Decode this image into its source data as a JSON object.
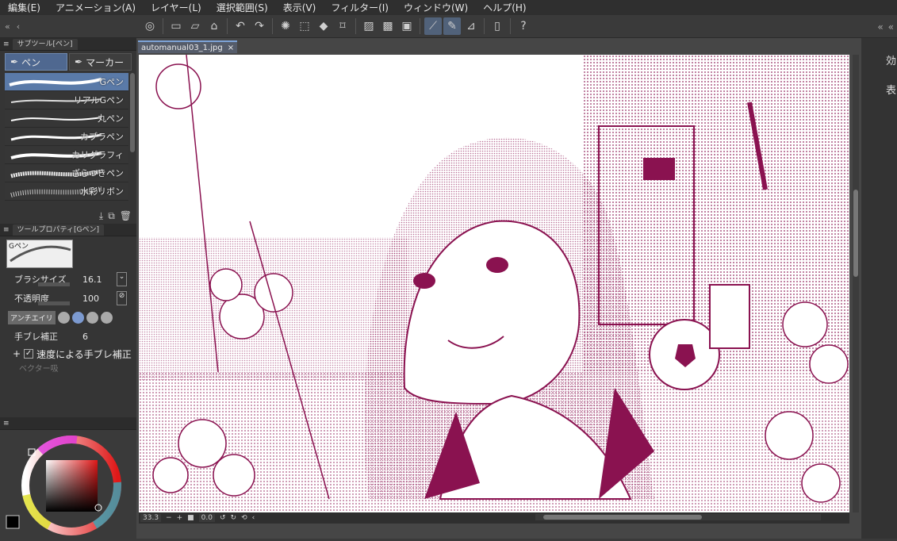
{
  "menu": [
    "編集(E)",
    "アニメーション(A)",
    "レイヤー(L)",
    "選択範囲(S)",
    "表示(V)",
    "フィルター(I)",
    "ウィンドウ(W)",
    "ヘルプ(H)"
  ],
  "subtool": {
    "panel_title": "サブツール[ペン]",
    "groups": [
      "ペン",
      "マーカー"
    ],
    "brushes": [
      "Gペン",
      "リアルGペン",
      "丸ペン",
      "カブラペン",
      "カリグラフィ",
      "ざらつきペン",
      "水彩リボン"
    ]
  },
  "toolprop": {
    "panel_title": "ツールプロパティ[Gペン]",
    "preview_label": "Gペン",
    "brush_size_label": "ブラシサイズ",
    "brush_size_value": "16.1",
    "opacity_label": "不透明度",
    "opacity_value": "100",
    "antialias_label": "アンチエイリ",
    "stabilization_label": "手ブレ補正",
    "stabilization_value": "6",
    "speed_stab_label": "速度による手ブレ補正",
    "vector_label": "ベクター吸"
  },
  "document": {
    "tab_title": "automanual03_1.jpg",
    "zoom": "33.3",
    "rotation": "0.0"
  },
  "right_panel_chars": [
    "効",
    "表"
  ],
  "colors": {
    "accent": "#7ea4d9",
    "ink": "#8a1250"
  }
}
